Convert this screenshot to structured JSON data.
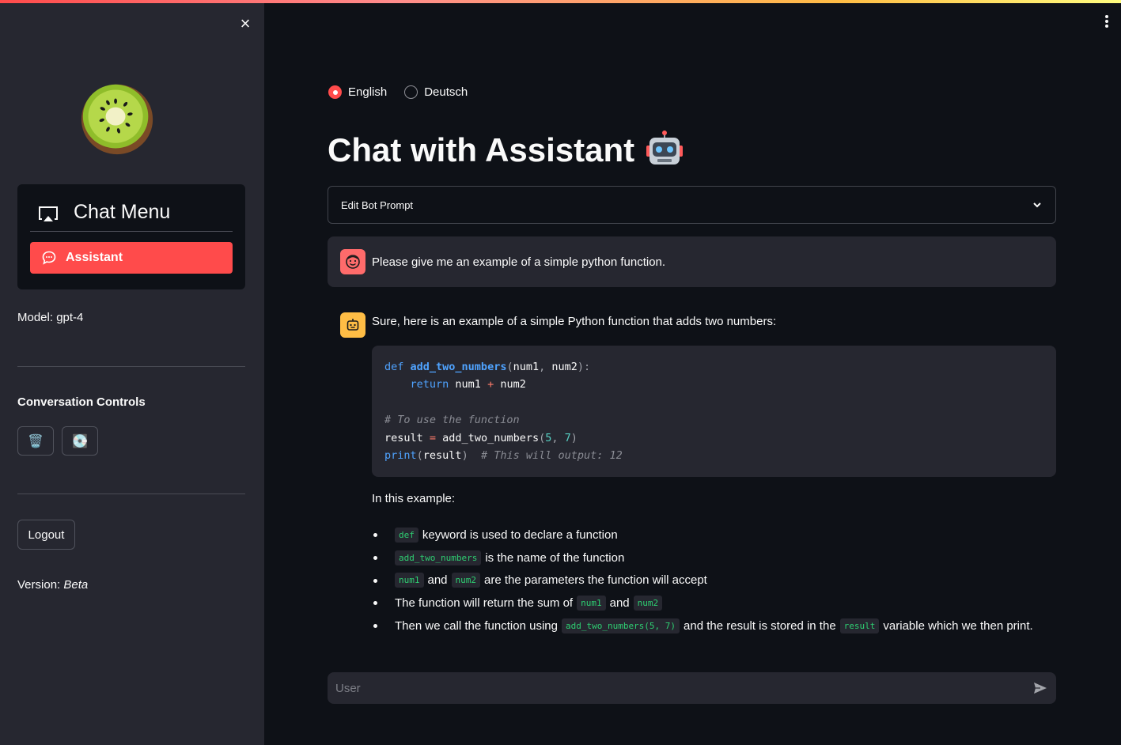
{
  "sidebar": {
    "close_icon": "×",
    "logo": "kiwi-logo",
    "chat_menu": {
      "title": "Chat Menu",
      "icon": "airplay-icon",
      "items": [
        {
          "label": "Assistant",
          "icon": "chat-bubble-icon",
          "active": true
        }
      ]
    },
    "model_text": "Model: gpt-4",
    "conversation_controls": {
      "heading": "Conversation Controls",
      "delete_icon": "🗑️",
      "save_icon": "💽"
    },
    "logout_label": "Logout",
    "version_label": "Version: ",
    "version_value": "Beta"
  },
  "header": {
    "menu_icon": "kebab-menu-icon",
    "accent_color": "#ff4b4b"
  },
  "language": {
    "options": [
      "English",
      "Deutsch"
    ],
    "selected": "English"
  },
  "main": {
    "title": "Chat with Assistant",
    "title_icon": "robot-icon",
    "expander_label": "Edit Bot Prompt",
    "input_placeholder": "User"
  },
  "messages": {
    "user": {
      "text": "Please give me an example of a simple python function."
    },
    "assistant": {
      "intro": "Sure, here is an example of a simple Python function that adds two numbers:",
      "code_lines": [
        "def add_two_numbers(num1, num2):",
        "    return num1 + num2",
        "",
        "# To use the function",
        "result = add_two_numbers(5, 7)",
        "print(result)  # This will output: 12"
      ],
      "example_label": "In this example:",
      "bullets": [
        {
          "code1": "def",
          "text1": "keyword is used to declare a function"
        },
        {
          "code1": "add_two_numbers",
          "text1": "is the name of the function"
        },
        {
          "code1": "num1",
          "text1": "and",
          "code2": "num2",
          "text2": "are the parameters the function will accept"
        },
        {
          "text0": "The function will return the sum of",
          "code1": "num1",
          "text1": "and",
          "code2": "num2"
        },
        {
          "text0": "Then we call the function using",
          "code1": "add_two_numbers(5, 7)",
          "text1": "and the result is stored in the",
          "code2": "result",
          "text2": "variable which we then print."
        }
      ]
    }
  }
}
